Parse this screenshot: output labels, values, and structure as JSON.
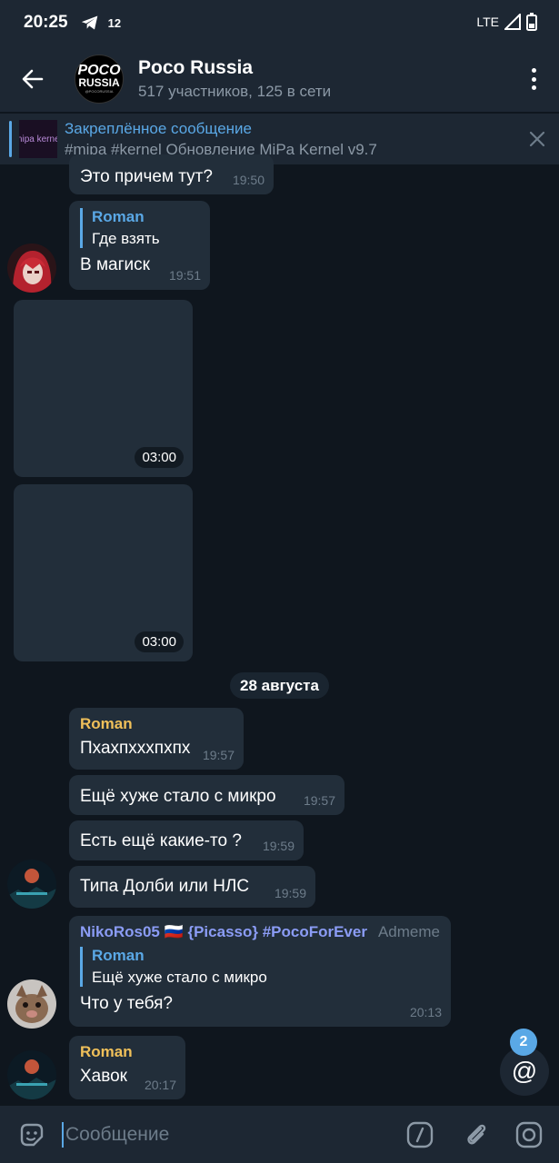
{
  "status_bar": {
    "time": "20:25",
    "notification_count": "12",
    "network": "LTE"
  },
  "header": {
    "title": "Poco Russia",
    "subtitle": "517 участников, 125 в сети",
    "avatar_line1": "POCO",
    "avatar_line2": "RUSSIA",
    "avatar_line3": "@POCORUSSIA"
  },
  "pinned": {
    "title": "Закреплённое сообщение",
    "text": "#mipa #kernel Обновление MiPa Kernel v9.7",
    "thumb_text": "mipa kernel"
  },
  "messages": [
    {
      "text": "Это причем тут?",
      "time": "19:50"
    },
    {
      "reply_name": "Roman",
      "reply_text": "Где взять",
      "text": "В магиск",
      "time": "19:51"
    },
    {
      "duration": "03:00"
    },
    {
      "duration": "03:00"
    },
    {
      "sender": "Roman",
      "text": "Пхахпхххпхпх",
      "time": "19:57"
    },
    {
      "text": "Ещё хуже стало с микро",
      "time": "19:57"
    },
    {
      "text": "Есть ещё какие-то ?",
      "time": "19:59"
    },
    {
      "text": "Типа Долби или НЛС",
      "time": "19:59"
    },
    {
      "sender": "NikoRos05 🇷🇺 {Picasso} #PocoForEver",
      "role": "Admeme",
      "reply_name": "Roman",
      "reply_text": "Ещё хуже стало с микро",
      "text": "Что у тебя?",
      "time": "20:13"
    },
    {
      "sender": "Roman",
      "text": "Хавок",
      "time": "20:17"
    }
  ],
  "date_separator": "28 августа",
  "mention_count": "2",
  "input": {
    "placeholder": "Сообщение"
  },
  "colors": {
    "accent": "#5aa8e6",
    "roman_name": "#f0c05a",
    "niko_name": "#8b9cf5"
  }
}
